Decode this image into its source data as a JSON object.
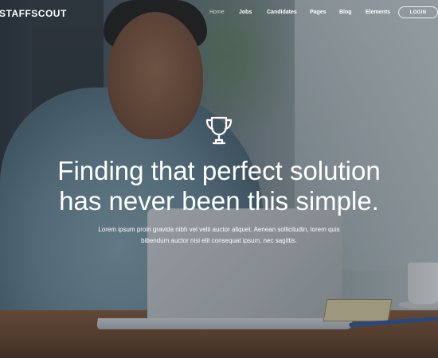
{
  "header": {
    "logo": "STAFFSCOUT",
    "nav": [
      {
        "label": "Home",
        "active": true
      },
      {
        "label": "Jobs"
      },
      {
        "label": "Candidates"
      },
      {
        "label": "Pages"
      },
      {
        "label": "Blog"
      },
      {
        "label": "Elements"
      }
    ],
    "login_label": "LOGIN"
  },
  "hero": {
    "icon": "trophy-icon",
    "headline_line1": "Finding that perfect solution",
    "headline_line2": "has never been this simple.",
    "subtext_line1": "Lorem ipsum proin gravida nibh vel velit auctor aliquet. Aenean sollicitudin, lorem quis",
    "subtext_line2": "bibendum auctor nisi elit consequat ipsum, nec sagittis."
  }
}
